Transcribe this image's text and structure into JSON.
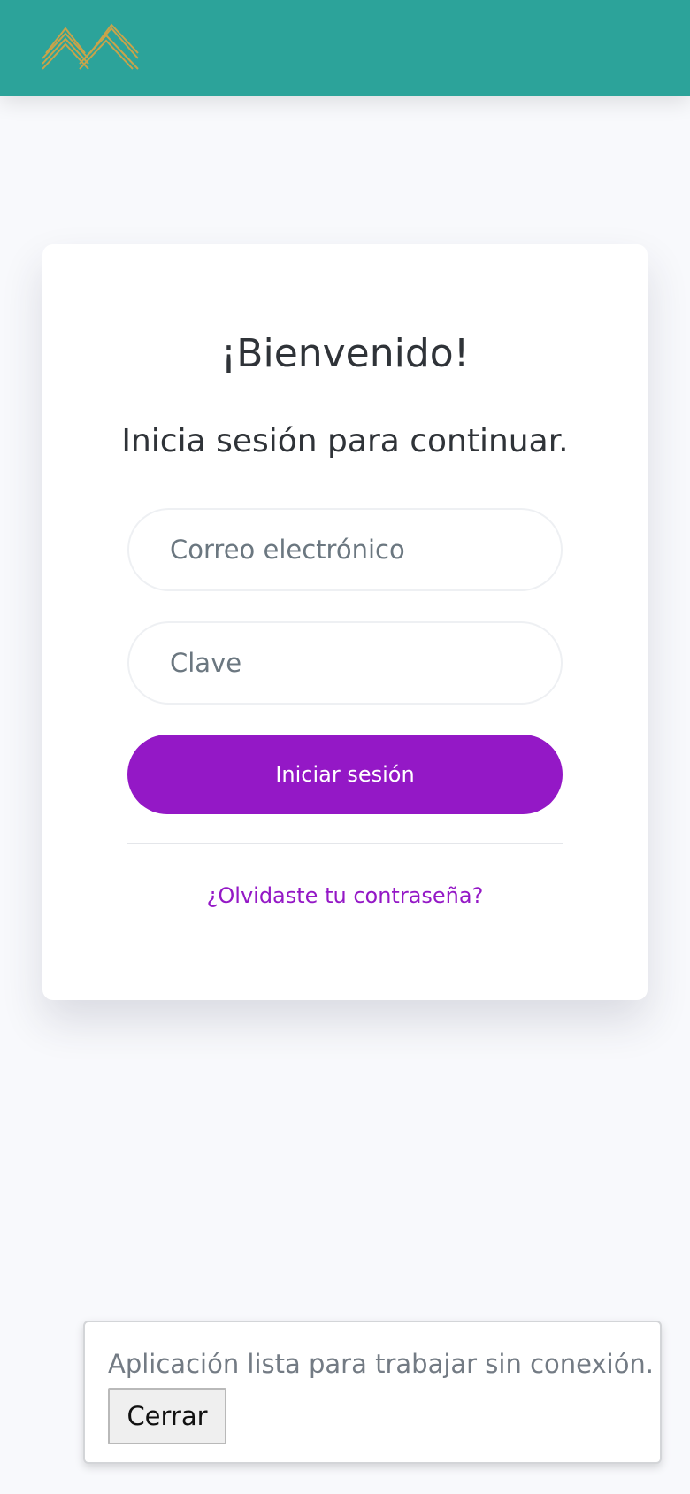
{
  "header": {
    "logo_icon": "chevron-logo-icon",
    "background_color": "#2ca39a",
    "logo_color": "#c9a34a"
  },
  "login": {
    "title": "¡Bienvenido!",
    "subtitle": "Inicia sesión para continuar.",
    "email_placeholder": "Correo electrónico",
    "password_placeholder": "Clave",
    "submit_label": "Iniciar sesión",
    "forgot_link": "¿Olvidaste tu contraseña?",
    "accent_color": "#9418c6"
  },
  "toast": {
    "message": "Aplicación lista para trabajar sin conexión.",
    "close_label": "Cerrar"
  }
}
